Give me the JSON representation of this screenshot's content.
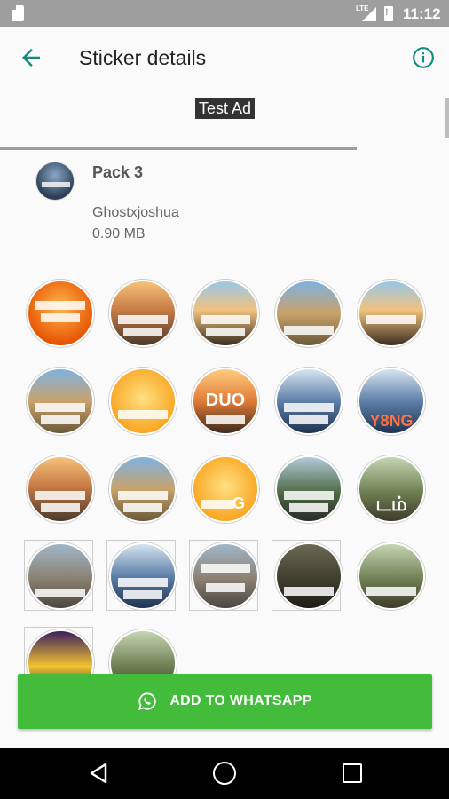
{
  "status_bar": {
    "network": "LTE",
    "time": "11:12",
    "icons": [
      "sd-card-icon",
      "signal-icon",
      "battery-icon"
    ]
  },
  "app_bar": {
    "title": "Sticker details",
    "back_icon": "arrow-back-icon",
    "info_icon": "info-icon"
  },
  "ad": {
    "label": "Test Ad"
  },
  "pack": {
    "name": "Pack 3",
    "author": "Ghostxjoshua",
    "size": "0.90 MB"
  },
  "stickers": {
    "overlay_texts": [
      "DUO",
      "Y8NG",
      "G",
      "டம்"
    ]
  },
  "add_button": {
    "label": "ADD TO WHATSAPP",
    "icon": "whatsapp-icon"
  },
  "nav": {
    "icons": [
      "nav-back-icon",
      "nav-home-icon",
      "nav-recent-icon"
    ]
  },
  "colors": {
    "accent": "#128c7e",
    "add_button": "#43bb3b",
    "status_bar": "#9e9e9e"
  }
}
